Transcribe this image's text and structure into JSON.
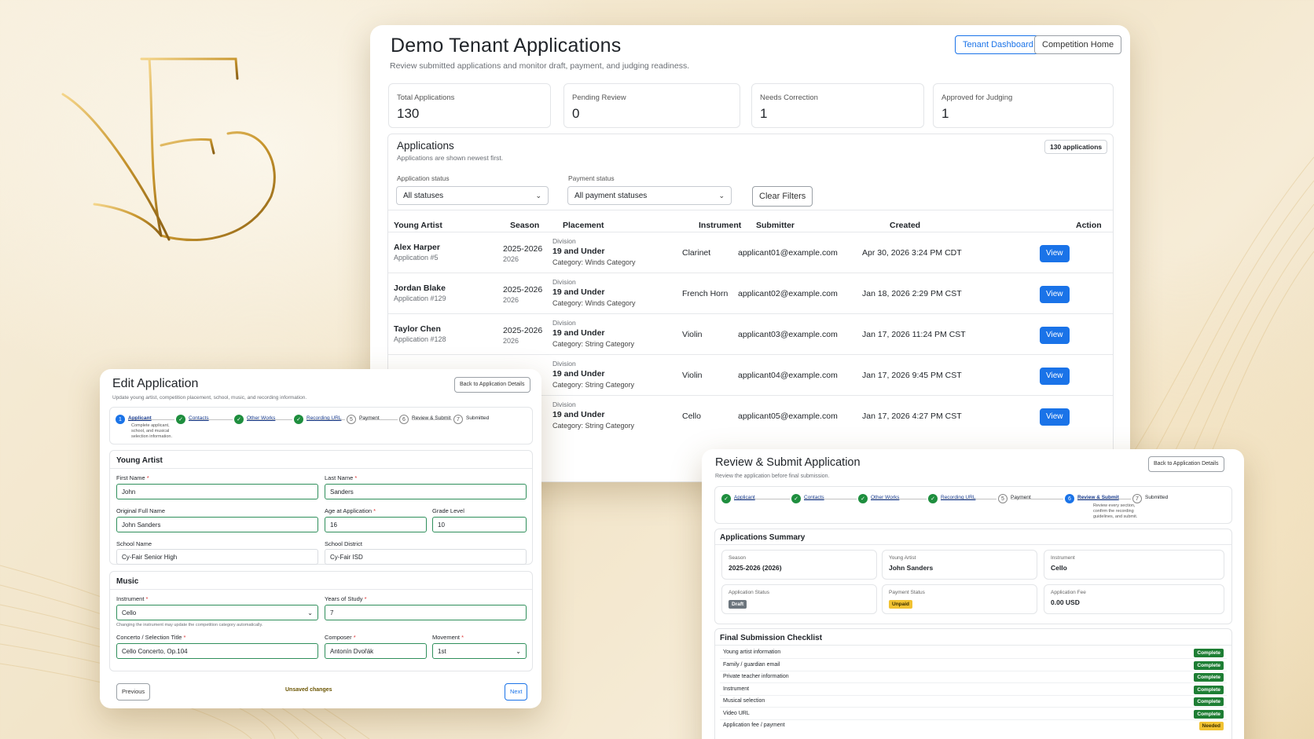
{
  "colors": {
    "accent": "#1a73e8",
    "success": "#1e8e3e",
    "warning": "#f1c232",
    "gold": "#c9a24a"
  },
  "main": {
    "title": "Demo Tenant Applications",
    "subtitle": "Review submitted applications and monitor draft, payment, and judging readiness.",
    "buttons": {
      "dashboard": "Tenant Dashboard",
      "home": "Competition Home"
    },
    "stats": [
      {
        "label": "Total Applications",
        "value": "130"
      },
      {
        "label": "Pending Review",
        "value": "0"
      },
      {
        "label": "Needs Correction",
        "value": "1"
      },
      {
        "label": "Approved for Judging",
        "value": "1"
      }
    ],
    "apps": {
      "title": "Applications",
      "subtitle": "Applications are shown newest first.",
      "count": "130 applications",
      "filter_status_label": "Application status",
      "filter_status_value": "All statuses",
      "filter_payment_label": "Payment status",
      "filter_payment_value": "All payment statuses",
      "clear": "Clear Filters",
      "columns": [
        "Young Artist",
        "Season",
        "Placement",
        "Instrument",
        "Submitter",
        "Created",
        "Action"
      ],
      "rows": [
        {
          "name": "Alex Harper",
          "app": "Application #5",
          "season": "2025-2026",
          "year": "2026",
          "div": "Division",
          "place": "19 and Under",
          "cat": "Category: Winds Category",
          "inst": "Clarinet",
          "email": "applicant01@example.com",
          "created": "Apr 30, 2026 3:24 PM CDT",
          "action": "View"
        },
        {
          "name": "Jordan Blake",
          "app": "Application #129",
          "season": "2025-2026",
          "year": "2026",
          "div": "Division",
          "place": "19 and Under",
          "cat": "Category: Winds Category",
          "inst": "French Horn",
          "email": "applicant02@example.com",
          "created": "Jan 18, 2026 2:29 PM CST",
          "action": "View"
        },
        {
          "name": "Taylor Chen",
          "app": "Application #128",
          "season": "2025-2026",
          "year": "2026",
          "div": "Division",
          "place": "19 and Under",
          "cat": "Category: String Category",
          "inst": "Violin",
          "email": "applicant03@example.com",
          "created": "Jan 17, 2026 11:24 PM CST",
          "action": "View"
        },
        {
          "name": "",
          "app": "",
          "season": "",
          "year": "26",
          "div": "Division",
          "place": "19 and Under",
          "cat": "Category: String Category",
          "inst": "Violin",
          "email": "applicant04@example.com",
          "created": "Jan 17, 2026 9:45 PM CST",
          "action": "View"
        },
        {
          "name": "",
          "app": "",
          "season": "",
          "year": "26",
          "div": "Division",
          "place": "19 and Under",
          "cat": "Category: String Category",
          "inst": "Cello",
          "email": "applicant05@example.com",
          "created": "Jan 17, 2026 4:27 PM CST",
          "action": "View"
        }
      ]
    }
  },
  "edit": {
    "title": "Edit Application",
    "subtitle": "Update young artist, competition placement, school, music, and recording information.",
    "back": "Back to Application Details",
    "steps": [
      {
        "n": "1",
        "label": "Applicant",
        "state": "cur"
      },
      {
        "n": "",
        "label": "Contacts",
        "state": "done"
      },
      {
        "n": "",
        "label": "Other Works",
        "state": "done"
      },
      {
        "n": "",
        "label": "Recording URL",
        "state": "done"
      },
      {
        "n": "5",
        "label": "Payment",
        "state": "todo"
      },
      {
        "n": "6",
        "label": "Review & Submit",
        "state": "todo"
      },
      {
        "n": "7",
        "label": "Submitted",
        "state": "todo"
      }
    ],
    "step_note": "Complete applicant, school, and musical selection information.",
    "young_artist": "Young Artist",
    "first_name_label": "First Name",
    "first_name": "John",
    "last_name_label": "Last Name",
    "last_name": "Sanders",
    "orig_label": "Original Full Name",
    "orig": "John Sanders",
    "age_label": "Age at Application",
    "age": "16",
    "grade_label": "Grade Level",
    "grade": "10",
    "school_label": "School Name",
    "school": "Cy-Fair Senior High",
    "district_label": "School District",
    "district": "Cy-Fair ISD",
    "music": "Music",
    "instrument_label": "Instrument",
    "instrument": "Cello",
    "years_label": "Years of Study",
    "years": "7",
    "inst_note": "Changing the instrument may update the competition category automatically.",
    "concerto_label": "Concerto / Selection Title",
    "concerto": "Cello Concerto, Op.104",
    "composer_label": "Composer",
    "composer": "Antonín Dvořák",
    "movement_label": "Movement",
    "movement": "1st",
    "previous": "Previous",
    "unsaved": "Unsaved changes",
    "next": "Next"
  },
  "review": {
    "title": "Review & Submit Application",
    "subtitle": "Review the application before final submission.",
    "back": "Back to Application Details",
    "steps": [
      {
        "n": "",
        "label": "Applicant",
        "state": "done"
      },
      {
        "n": "",
        "label": "Contacts",
        "state": "done"
      },
      {
        "n": "",
        "label": "Other Works",
        "state": "done"
      },
      {
        "n": "",
        "label": "Recording URL",
        "state": "done"
      },
      {
        "n": "5",
        "label": "Payment",
        "state": "todo"
      },
      {
        "n": "6",
        "label": "Review & Submit",
        "state": "cur"
      },
      {
        "n": "7",
        "label": "Submitted",
        "state": "todo"
      }
    ],
    "step_note": "Review every section, confirm the recording guidelines, and submit.",
    "summary_title": "Applications Summary",
    "summary": [
      {
        "label": "Season",
        "value": "2025-2026 (2026)"
      },
      {
        "label": "Young Artist",
        "value": "John Sanders"
      },
      {
        "label": "Instrument",
        "value": "Cello"
      },
      {
        "label": "Application Status",
        "badge": "Draft"
      },
      {
        "label": "Payment Status",
        "badge": "Unpaid"
      },
      {
        "label": "Application Fee",
        "value": "0.00 USD"
      }
    ],
    "checklist_title": "Final Submission Checklist",
    "checklist": [
      {
        "item": "Young artist information",
        "status": "Complete"
      },
      {
        "item": "Family / guardian email",
        "status": "Complete"
      },
      {
        "item": "Private teacher information",
        "status": "Complete"
      },
      {
        "item": "Instrument",
        "status": "Complete"
      },
      {
        "item": "Musical selection",
        "status": "Complete"
      },
      {
        "item": "Video URL",
        "status": "Complete"
      },
      {
        "item": "Application fee / payment",
        "status": "Needed"
      }
    ]
  }
}
